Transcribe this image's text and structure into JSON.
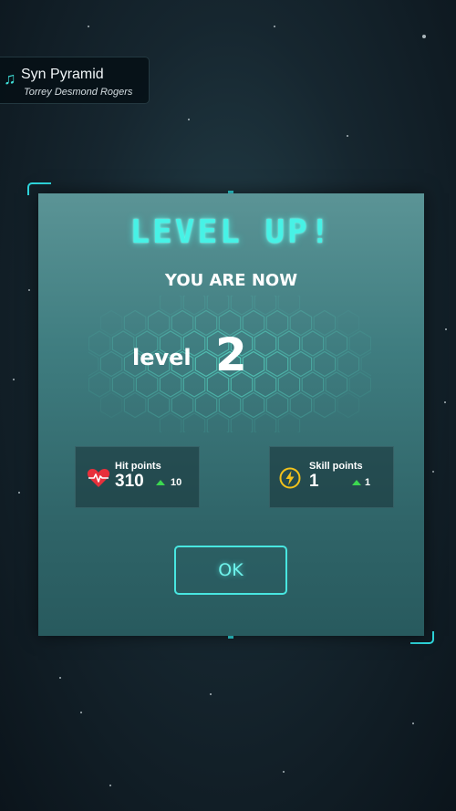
{
  "music": {
    "icon": "music-note-icon",
    "track": "Syn Pyramid",
    "artist": "Torrey Desmond Rogers"
  },
  "dialog": {
    "title": "LEVEL UP!",
    "subtitle": "YOU ARE NOW",
    "level_word": "level",
    "level_value": "2"
  },
  "stats": [
    {
      "icon": "heart-pulse-icon",
      "label": "Hit points",
      "value": "310",
      "gain": "10"
    },
    {
      "icon": "lightning-bolt-icon",
      "label": "Skill points",
      "value": "1",
      "gain": "1"
    }
  ],
  "ok_label": "OK",
  "colors": {
    "accent": "#47f2e6",
    "heart": "#e8303b",
    "bolt": "#f2c21b",
    "gain_arrow": "#3cd850"
  }
}
